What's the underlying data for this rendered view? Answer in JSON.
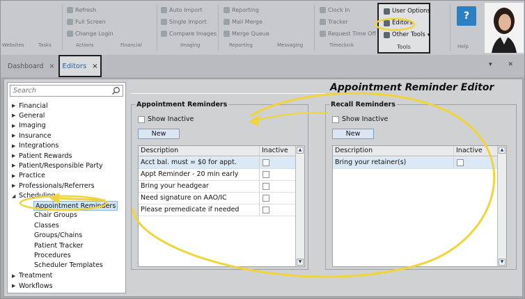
{
  "ribbon": {
    "groups": [
      {
        "name": "Websites",
        "items": []
      },
      {
        "name": "Tasks",
        "items": []
      },
      {
        "name": "Actions",
        "items": [
          "Refresh",
          "Full Screen",
          "Change Login"
        ]
      },
      {
        "name": "Financial",
        "items": []
      },
      {
        "name": "Imaging",
        "items": [
          "Auto Import",
          "Single Import",
          "Compare Images"
        ]
      },
      {
        "name": "Reporting",
        "items": [
          "Reporting",
          "Mail Merge",
          "Merge Queue"
        ]
      },
      {
        "name": "Messaging",
        "items": []
      },
      {
        "name": "Timeclock",
        "items": [
          "Clock In",
          "Tracker",
          "Request Time Off"
        ]
      }
    ],
    "tools": {
      "name": "Tools",
      "items": [
        "User Options",
        "Editors",
        "Other Tools"
      ]
    },
    "help": {
      "label": "Help",
      "icon": "help-icon"
    }
  },
  "tabs": {
    "dashboard": "Dashboard",
    "editors": "Editors",
    "close_glyph": "×"
  },
  "window_controls": "▾ ✕",
  "sidebar": {
    "search_placeholder": "Search",
    "nodes": [
      {
        "label": "Financial",
        "expanded": false
      },
      {
        "label": "General",
        "expanded": false
      },
      {
        "label": "Imaging",
        "expanded": false
      },
      {
        "label": "Insurance",
        "expanded": false
      },
      {
        "label": "Integrations",
        "expanded": false
      },
      {
        "label": "Patient Rewards",
        "expanded": false
      },
      {
        "label": "Patient/Responsible Party",
        "expanded": false
      },
      {
        "label": "Practice",
        "expanded": false
      },
      {
        "label": "Professionals/Referrers",
        "expanded": false
      },
      {
        "label": "Scheduling",
        "expanded": true
      },
      {
        "label": "Treatment",
        "expanded": false
      },
      {
        "label": "Workflows",
        "expanded": false
      }
    ],
    "scheduling_children": [
      "Appointment Reminders",
      "Chair Groups",
      "Classes",
      "Groups/Chains",
      "Patient Tracker",
      "Procedures",
      "Scheduler Templates"
    ],
    "selected": "Appointment Reminders"
  },
  "editor": {
    "title": "Appointment Reminder Editor",
    "appointment": {
      "title": "Appointment Reminders",
      "show_inactive": "Show Inactive",
      "new_label": "New",
      "columns": [
        "Description",
        "Inactive"
      ],
      "rows": [
        {
          "description": "Acct bal. must = $0 for appt.",
          "inactive": false
        },
        {
          "description": "Appt Reminder - 20 min early",
          "inactive": false
        },
        {
          "description": "Bring your headgear",
          "inactive": false
        },
        {
          "description": "Need signature on AAO/IC",
          "inactive": false
        },
        {
          "description": "Please premedicate if needed",
          "inactive": false
        }
      ]
    },
    "recall": {
      "title": "Recall Reminders",
      "show_inactive": "Show Inactive",
      "new_label": "New",
      "columns": [
        "Description",
        "Inactive"
      ],
      "rows": [
        {
          "description": "Bring your retainer(s)",
          "inactive": false
        }
      ]
    }
  },
  "colors": {
    "annotation": "#f1d43a",
    "accent": "#2b5fa3",
    "selection": "#cfe5f8"
  }
}
